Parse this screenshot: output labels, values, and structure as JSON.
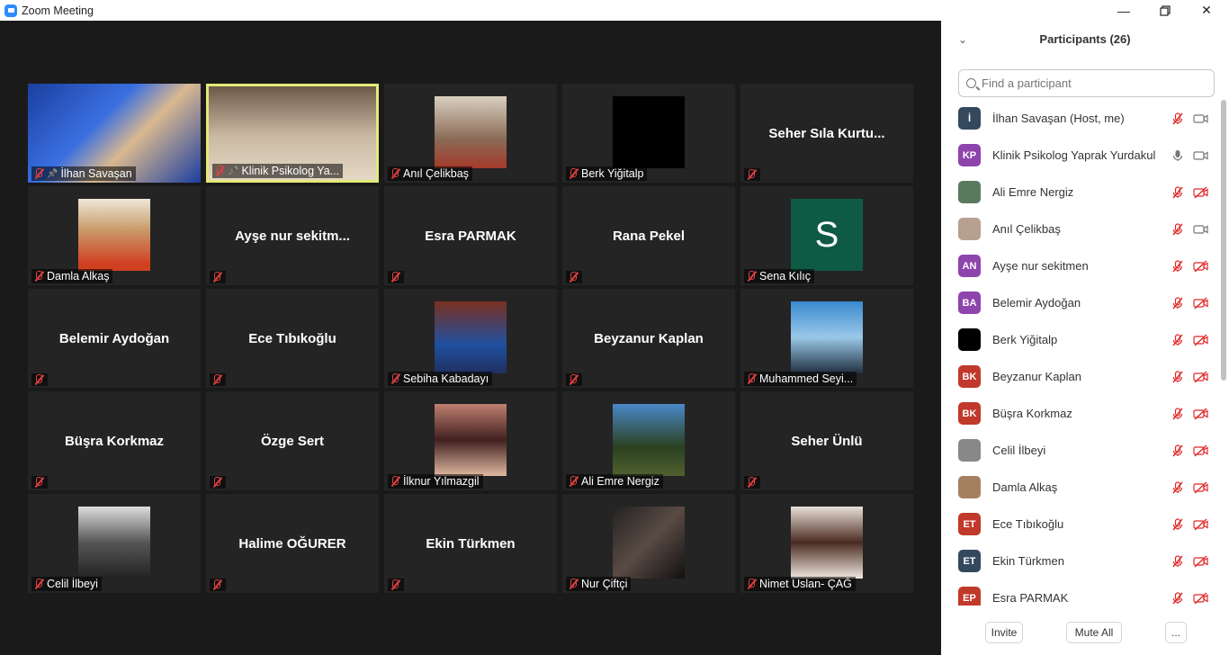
{
  "window": {
    "title": "Zoom Meeting"
  },
  "grid": {
    "tiles": [
      {
        "name": "İlhan Savaşan",
        "display": "photo",
        "pinned": true,
        "active": false
      },
      {
        "name": "Klinik Psikolog Ya...",
        "display": "photo",
        "pinned": true,
        "active": true
      },
      {
        "name": "Anıl Çelikbaş",
        "display": "photo",
        "pinned": false,
        "active": false
      },
      {
        "name": "Berk Yiğitalp",
        "display": "photo",
        "pinned": false,
        "active": false
      },
      {
        "name": "",
        "display": "text",
        "text": "Seher Sıla Kurtu...",
        "pinned": false,
        "active": false
      },
      {
        "name": "Damla Alkaş",
        "display": "photo",
        "pinned": false,
        "active": false
      },
      {
        "name": "",
        "display": "text",
        "text": "Ayşe nur sekitm...",
        "pinned": false,
        "active": false
      },
      {
        "name": "",
        "display": "text",
        "text": "Esra PARMAK",
        "pinned": false,
        "active": false
      },
      {
        "name": "",
        "display": "text",
        "text": "Rana Pekel",
        "pinned": false,
        "active": false
      },
      {
        "name": "Sena Kılıç",
        "display": "letter",
        "letter": "S",
        "pinned": false,
        "active": false
      },
      {
        "name": "",
        "display": "text",
        "text": "Belemir Aydoğan",
        "pinned": false,
        "active": false
      },
      {
        "name": "",
        "display": "text",
        "text": "Ece Tıbıkoğlu",
        "pinned": false,
        "active": false
      },
      {
        "name": "Sebiha Kabadayı",
        "display": "photo",
        "pinned": false,
        "active": false
      },
      {
        "name": "",
        "display": "text",
        "text": "Beyzanur Kaplan",
        "pinned": false,
        "active": false
      },
      {
        "name": "Muhammed Seyi...",
        "display": "photo",
        "pinned": false,
        "active": false
      },
      {
        "name": "",
        "display": "text",
        "text": "Büşra Korkmaz",
        "pinned": false,
        "active": false
      },
      {
        "name": "",
        "display": "text",
        "text": "Özge Sert",
        "pinned": false,
        "active": false
      },
      {
        "name": "İlknur Yılmazgil",
        "display": "photo",
        "pinned": false,
        "active": false
      },
      {
        "name": "Ali Emre Nergiz",
        "display": "photo",
        "pinned": false,
        "active": false
      },
      {
        "name": "",
        "display": "text",
        "text": "Seher Ünlü",
        "pinned": false,
        "active": false
      },
      {
        "name": "Celil İlbeyi",
        "display": "photo",
        "pinned": false,
        "active": false
      },
      {
        "name": "",
        "display": "text",
        "text": "Halime OĞURER",
        "pinned": false,
        "active": false
      },
      {
        "name": "",
        "display": "text",
        "text": "Ekin Türkmen",
        "pinned": false,
        "active": false
      },
      {
        "name": "Nur Çiftçi",
        "display": "photo",
        "pinned": false,
        "active": false
      },
      {
        "name": "Nimet Uslan- ÇAĞ",
        "display": "photo",
        "pinned": false,
        "active": false
      }
    ]
  },
  "participants": {
    "title": "Participants (26)",
    "search_placeholder": "Find a participant",
    "items": [
      {
        "name": "İlhan Savaşan (Host, me)",
        "initials": "İ",
        "color": "#34495e",
        "mic": "muted",
        "video": "on"
      },
      {
        "name": "Klinik Psikolog Yaprak Yurdakul",
        "initials": "KP",
        "color": "#8e44ad",
        "mic": "on",
        "video": "on"
      },
      {
        "name": "Ali Emre Nergiz",
        "initials": "",
        "color": "#5a7a60",
        "mic": "muted",
        "video": "off"
      },
      {
        "name": "Anıl Çelikbaş",
        "initials": "",
        "color": "#b8a090",
        "mic": "muted",
        "video": "on"
      },
      {
        "name": "Ayşe nur sekitmen",
        "initials": "AN",
        "color": "#8e44ad",
        "mic": "muted",
        "video": "off"
      },
      {
        "name": "Belemir Aydoğan",
        "initials": "BA",
        "color": "#8e44ad",
        "mic": "muted",
        "video": "off"
      },
      {
        "name": "Berk Yiğitalp",
        "initials": "",
        "color": "#000000",
        "mic": "muted",
        "video": "off"
      },
      {
        "name": "Beyzanur Kaplan",
        "initials": "BK",
        "color": "#c0392b",
        "mic": "muted",
        "video": "off"
      },
      {
        "name": "Büşra Korkmaz",
        "initials": "BK",
        "color": "#c0392b",
        "mic": "muted",
        "video": "off"
      },
      {
        "name": "Celil İlbeyi",
        "initials": "",
        "color": "#888888",
        "mic": "muted",
        "video": "off"
      },
      {
        "name": "Damla Alkaş",
        "initials": "",
        "color": "#a58060",
        "mic": "muted",
        "video": "off"
      },
      {
        "name": "Ece Tıbıkoğlu",
        "initials": "ET",
        "color": "#c0392b",
        "mic": "muted",
        "video": "off"
      },
      {
        "name": "Ekin Türkmen",
        "initials": "ET",
        "color": "#34495e",
        "mic": "muted",
        "video": "off"
      },
      {
        "name": "Esra PARMAK",
        "initials": "EP",
        "color": "#c0392b",
        "mic": "muted",
        "video": "off"
      }
    ],
    "buttons": {
      "invite": "Invite",
      "mute_all": "Mute All",
      "more": "..."
    }
  }
}
